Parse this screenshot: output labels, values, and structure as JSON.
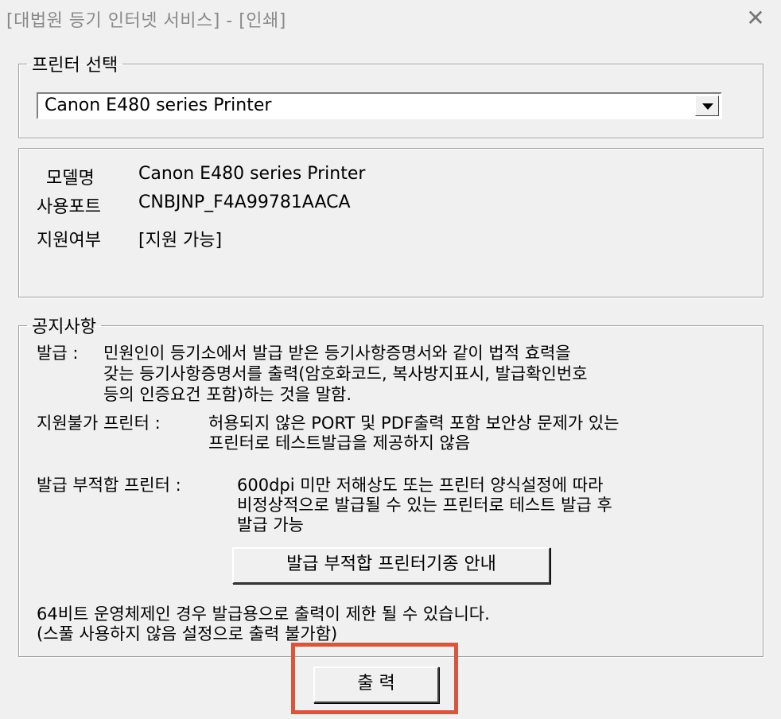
{
  "window": {
    "title": "[대법원 등기 인터넷 서비스] - [인쇄]",
    "close_glyph": "✕"
  },
  "printer_group": {
    "legend": "프린터 선택",
    "selected_printer": "Canon E480 series Printer"
  },
  "info": {
    "model_label": "모델명",
    "model_value": "Canon E480 series Printer",
    "port_label": "사용포트",
    "port_value": "CNBJNP_F4A99781AACA",
    "support_label": "지원여부",
    "support_value": "[지원 가능]"
  },
  "notice_group": {
    "legend": "공지사항",
    "issue_label": "발급 : ",
    "issue_line1": "민원인이 등기소에서 발급 받은 등기사항증명서와 같이 법적 효력을",
    "issue_line2": "갖는 등기사항증명서를 출력(암호화코드, 복사방지표시, 발급확인번호",
    "issue_line3": "등의 인증요건 포함)하는 것을 말함.",
    "unsupported_label": "지원불가 프린터 : ",
    "unsupported_line1": "허용되지 않은 PORT 및 PDF출력 포함 보안상 문제가 있는",
    "unsupported_line2": "프린터로 테스트발급을 제공하지 않음",
    "unsuitable_label": "발급 부적합 프린터 : ",
    "unsuitable_line1": "600dpi 미만 저해상도 또는 프린터 양식설정에 따라",
    "unsuitable_line2": "비정상적으로 발급될 수 있는 프린터로 테스트 발급 후",
    "unsuitable_line3": "발급 가능",
    "guide_button": "발급 부적합 프린터기종 안내",
    "os_line1": "64비트 운영체제인 경우 발급용으로 출력이 제한 될 수 있습니다.",
    "os_line2": "(스풀 사용하지 않음 설정으로 출력 불가함)"
  },
  "print_button": "출 력",
  "colors": {
    "highlight": "#d9553e",
    "background": "#f0f0f0"
  }
}
